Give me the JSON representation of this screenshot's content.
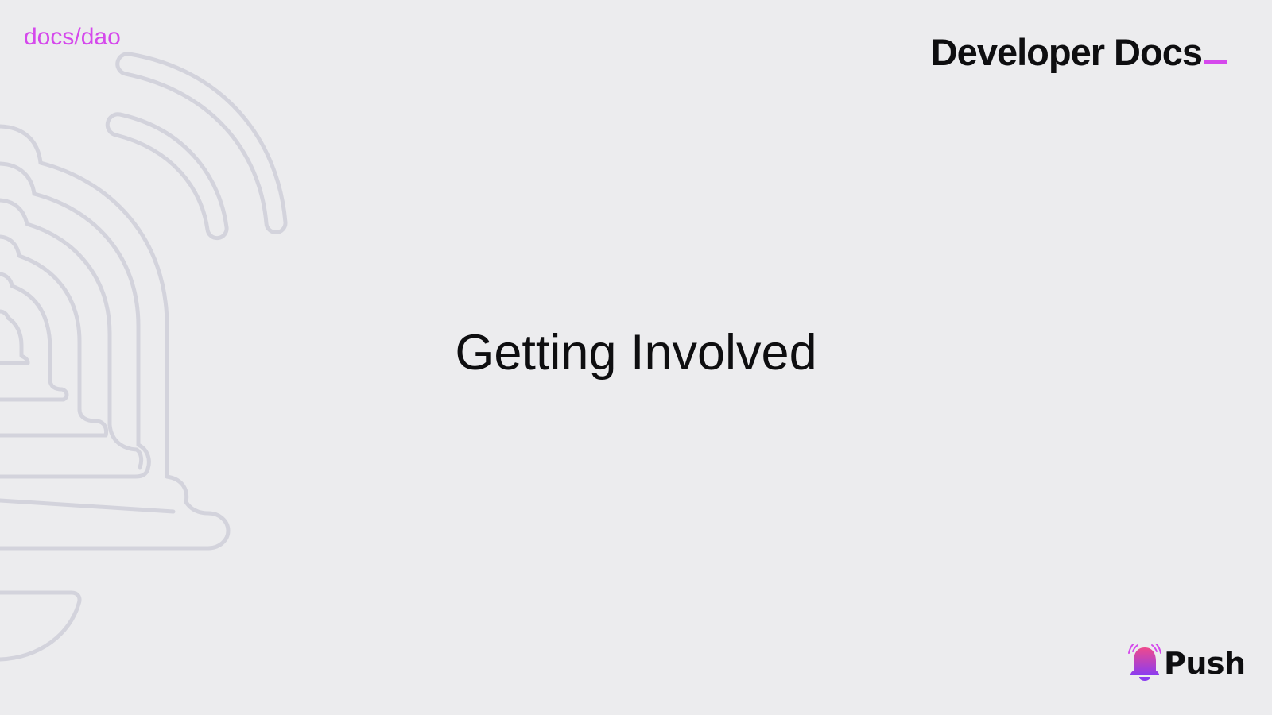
{
  "header": {
    "breadcrumb": "docs/dao",
    "brand_title": "Developer Docs"
  },
  "main": {
    "title": "Getting Involved"
  },
  "footer": {
    "logo_text": "Push",
    "logo_icon": "bell-icon"
  },
  "colors": {
    "background": "#ececee",
    "accent": "#d548ec",
    "text": "#0e0e10",
    "decoration": "#d3d3dc"
  }
}
